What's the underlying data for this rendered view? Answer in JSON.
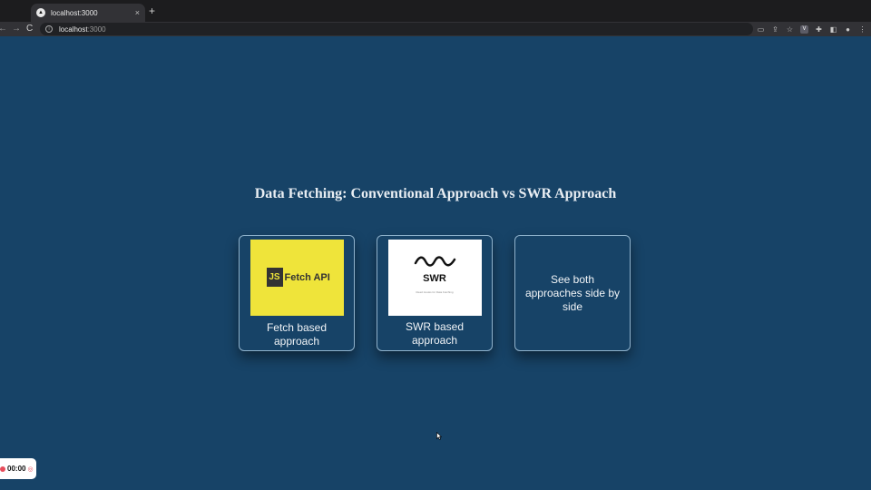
{
  "browser": {
    "tab_title": "localhost:3000",
    "tab_close": "×",
    "new_tab": "+",
    "url_host": "localhost",
    "url_port": ":3000",
    "back": "←",
    "forward": "→",
    "reload": "C"
  },
  "page": {
    "title": "Data Fetching: Conventional Approach vs SWR Approach",
    "cards": [
      {
        "image_badge": "JS",
        "image_text": "Fetch API",
        "label": "Fetch based approach"
      },
      {
        "image_text": "SWR",
        "image_subtext": "React Hooks for Data Fetching",
        "label": "SWR based approach"
      },
      {
        "label": "See both approaches side by side"
      }
    ]
  },
  "recorder": {
    "time": "00:00"
  },
  "icons": [
    "tab-favicon",
    "info-icon",
    "cast-icon",
    "share-icon",
    "star-icon",
    "extension-v-icon",
    "puzzle-icon",
    "sidebar-icon",
    "profile-icon",
    "record-icon",
    "camera-icon",
    "pointer-cursor"
  ],
  "colors": {
    "background": "#174367",
    "card_border": "#8fb2cc",
    "fetch_yellow": "#efe43a",
    "recorder_red": "#e74c5b"
  }
}
